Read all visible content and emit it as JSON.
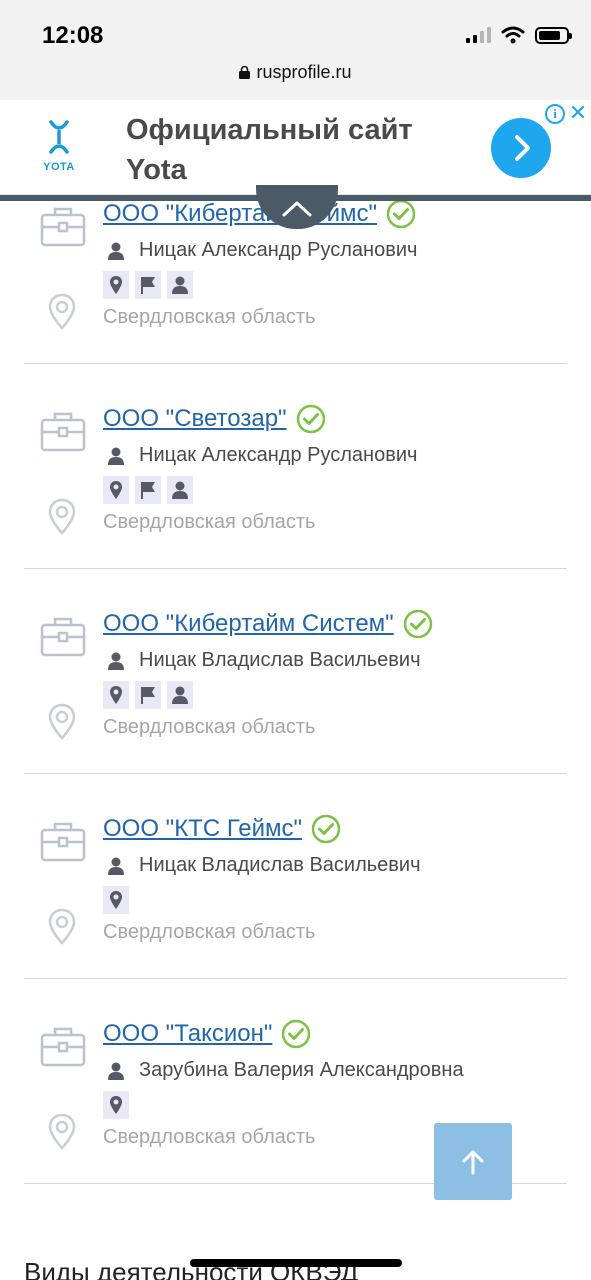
{
  "status_bar": {
    "time": "12:08",
    "url": "rusprofile.ru"
  },
  "ad": {
    "logo_text": "YOTA",
    "title": "Официальный сайт Yota",
    "info_symbol": "i",
    "close_symbol": "✕"
  },
  "companies": [
    {
      "name": "ООО \"Кибертайм Геймс\"",
      "person": "Ницак Александр Русланович",
      "badges": [
        "pin-icon",
        "flag-icon",
        "person-icon"
      ],
      "region": "Свердловская область"
    },
    {
      "name": "ООО \"Светозар\"",
      "person": "Ницак Александр Русланович",
      "badges": [
        "pin-icon",
        "flag-icon",
        "person-icon"
      ],
      "region": "Свердловская область"
    },
    {
      "name": "ООО \"Кибертайм Систем\"",
      "person": "Ницак Владислав Васильевич",
      "badges": [
        "pin-icon",
        "flag-icon",
        "person-icon"
      ],
      "region": "Свердловская область"
    },
    {
      "name": "ООО \"КТС Геймс\"",
      "person": "Ницак Владислав Васильевич",
      "badges": [
        "pin-icon"
      ],
      "region": "Свердловская область"
    },
    {
      "name": "ООО \"Таксион\"",
      "person": "Зарубина Валерия Александровна",
      "badges": [
        "pin-icon"
      ],
      "region": "Свердловская область"
    }
  ],
  "section_title": "Виды деятельности ОКВЭД",
  "colors": {
    "link": "#2266aa",
    "check": "#7dc242",
    "ad_accent": "#1ea6ee",
    "scroll_top": "#8cbfe3"
  }
}
